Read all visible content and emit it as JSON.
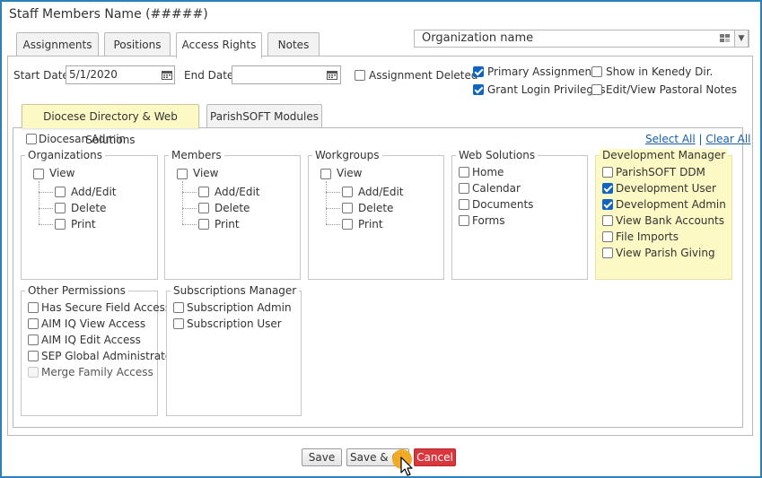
{
  "window": {
    "title": "Staff Members Name (#####)"
  },
  "tabs": [
    {
      "label": "Assignments",
      "active": false
    },
    {
      "label": "Positions",
      "active": false
    },
    {
      "label": "Access Rights",
      "active": true
    },
    {
      "label": "Notes",
      "active": false
    }
  ],
  "organization_select": {
    "value": "Organization name"
  },
  "form": {
    "start_date_label": "Start Date:",
    "start_date_value": "5/1/2020",
    "end_date_label": "End Date:",
    "end_date_value": "",
    "assignment_deleted": {
      "label": "Assignment Deleted",
      "checked": false
    },
    "primary_assignment": {
      "label": "Primary Assignment",
      "checked": true
    },
    "grant_login": {
      "label": "Grant Login Privileges",
      "checked": true
    },
    "show_kenedy": {
      "label": "Show in Kenedy Dir.",
      "checked": false
    },
    "edit_pastoral": {
      "label": "Edit/View Pastoral Notes",
      "checked": false
    }
  },
  "inner_tabs": [
    {
      "label": "Diocese Directory & Web Solutions",
      "active": true
    },
    {
      "label": "ParishSOFT Modules",
      "active": false
    }
  ],
  "diocesan_admin": {
    "label": "Diocesan Admin",
    "checked": false
  },
  "select_links": {
    "select_all": "Select All",
    "separator": "|",
    "clear_all": "Clear All"
  },
  "groups": {
    "organizations": {
      "title": "Organizations",
      "view": "View",
      "add_edit": "Add/Edit",
      "delete": "Delete",
      "print": "Print"
    },
    "members": {
      "title": "Members",
      "view": "View",
      "add_edit": "Add/Edit",
      "delete": "Delete",
      "print": "Print"
    },
    "workgroups": {
      "title": "Workgroups",
      "view": "View",
      "add_edit": "Add/Edit",
      "delete": "Delete",
      "print": "Print"
    },
    "web_solutions": {
      "title": "Web Solutions",
      "items": [
        "Home",
        "Calendar",
        "Documents",
        "Forms"
      ]
    },
    "development_manager": {
      "title": "Development Manager",
      "items": [
        {
          "label": "ParishSOFT DDM",
          "checked": false
        },
        {
          "label": "Development User",
          "checked": true
        },
        {
          "label": "Development Admin",
          "checked": true
        },
        {
          "label": "View Bank Accounts",
          "checked": false
        },
        {
          "label": "File Imports",
          "checked": false
        },
        {
          "label": "View Parish Giving",
          "checked": false
        }
      ]
    },
    "other_permissions": {
      "title": "Other Permissions",
      "items": [
        {
          "label": "Has Secure Field Access",
          "disabled": false
        },
        {
          "label": "AIM IQ View Access",
          "disabled": false
        },
        {
          "label": "AIM IQ Edit Access",
          "disabled": false
        },
        {
          "label": "SEP Global Administrator",
          "disabled": false
        },
        {
          "label": "Merge Family Access",
          "disabled": true
        }
      ]
    },
    "subscriptions_manager": {
      "title": "Subscriptions Manager",
      "items": [
        "Subscription Admin",
        "Subscription User"
      ]
    }
  },
  "buttons": {
    "save": "Save",
    "save_close": "Save & Cl",
    "cancel": "Cancel"
  },
  "colors": {
    "frame": "#2d7fb8",
    "highlight": "#fdf9c4",
    "checked": "#0f65c3",
    "cancel": "#d9363e",
    "link": "#1a5fa8",
    "cursor": "#f2a81d"
  }
}
